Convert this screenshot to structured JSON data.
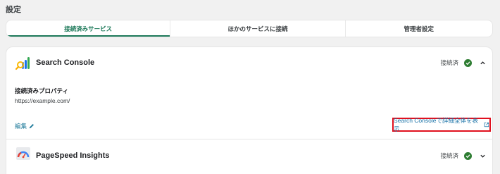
{
  "page": {
    "title": "設定"
  },
  "tabs": [
    {
      "label": "接続済みサービス",
      "active": true
    },
    {
      "label": "ほかのサービスに接続",
      "active": false
    },
    {
      "label": "管理者設定",
      "active": false
    }
  ],
  "services": [
    {
      "name": "Search Console",
      "icon": "search-console-logo",
      "status": "接続済",
      "expanded": true,
      "property_label": "接続済みプロパティ",
      "property_value": "https://example.com/",
      "edit_label": "編集",
      "detail_link_label": "Search Consoleで詳細全体を表示"
    },
    {
      "name": "PageSpeed Insights",
      "icon": "pagespeed-insights-logo",
      "status": "接続済",
      "expanded": false
    }
  ],
  "colors": {
    "accent": "#1e7a5a",
    "link": "#1a73a8",
    "status_ok": "#2e7d32",
    "highlight_box": "#e0101e"
  }
}
